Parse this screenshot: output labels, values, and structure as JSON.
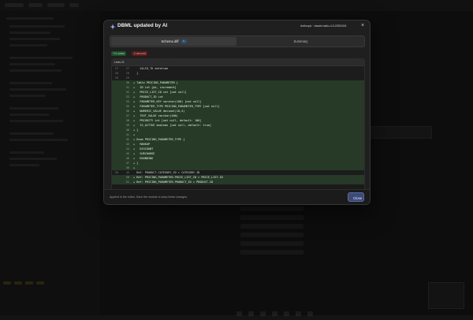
{
  "modal": {
    "title": "DBML updated by AI",
    "model_label": "Anthropic · claude-haiku-4-5-20251001",
    "close_icon_glyph": "×"
  },
  "tabs": {
    "schema_diff": "Schema diff",
    "schema_diff_badge": "1",
    "summary": "Summary"
  },
  "stats": {
    "added": "+21 added",
    "removed": "-0 removed"
  },
  "diff": {
    "header": "Lines 21",
    "lines": [
      {
        "old": "27",
        "new": "27",
        "type": "ctx",
        "code": "    VALID_TO datetime"
      },
      {
        "old": "28",
        "new": "28",
        "type": "ctx",
        "code": "  }"
      },
      {
        "old": "29",
        "new": "29",
        "type": "ctx",
        "code": ""
      },
      {
        "old": "",
        "new": "30",
        "type": "add",
        "code": "+ Table PRICING_PARAMETER {"
      },
      {
        "old": "",
        "new": "31",
        "type": "add",
        "code": "+   ID int [pk, increment]"
      },
      {
        "old": "",
        "new": "32",
        "type": "add",
        "code": "+   PRICE_LIST_ID int [not null]"
      },
      {
        "old": "",
        "new": "33",
        "type": "add",
        "code": "+   PRODUCT_ID int"
      },
      {
        "old": "",
        "new": "34",
        "type": "add",
        "code": "+   PARAMETER_KEY varchar(100) [not null]"
      },
      {
        "old": "",
        "new": "35",
        "type": "add",
        "code": "+   PARAMETER_TYPE PRICING_PARAMETER_TYPE [not null]"
      },
      {
        "old": "",
        "new": "36",
        "type": "add",
        "code": "+   NUMERIC_VALUE decimal(18,4)"
      },
      {
        "old": "",
        "new": "37",
        "type": "add",
        "code": "+   TEXT_VALUE varchar(400)"
      },
      {
        "old": "",
        "new": "38",
        "type": "add",
        "code": "+   PRIORITY int [not null, default: 100]"
      },
      {
        "old": "",
        "new": "39",
        "type": "add",
        "code": "+   IS_ACTIVE boolean [not null, default: true]"
      },
      {
        "old": "",
        "new": "40",
        "type": "add",
        "code": "+ }"
      },
      {
        "old": "",
        "new": "41",
        "type": "add",
        "code": "+"
      },
      {
        "old": "",
        "new": "42",
        "type": "add",
        "code": "+ Enum PRICING_PARAMETER_TYPE {"
      },
      {
        "old": "",
        "new": "43",
        "type": "add",
        "code": "+   MARKUP"
      },
      {
        "old": "",
        "new": "44",
        "type": "add",
        "code": "+   DISCOUNT"
      },
      {
        "old": "",
        "new": "45",
        "type": "add",
        "code": "+   SURCHARGE"
      },
      {
        "old": "",
        "new": "46",
        "type": "add",
        "code": "+   ROUNDING"
      },
      {
        "old": "",
        "new": "47",
        "type": "add",
        "code": "+ }"
      },
      {
        "old": "",
        "new": "48",
        "type": "add",
        "code": "+"
      },
      {
        "old": "30",
        "new": "49",
        "type": "ctx",
        "code": "  Ref: PRODUCT.CATEGORY_ID > CATEGORY.ID"
      },
      {
        "old": "",
        "new": "50",
        "type": "add",
        "code": "+ Ref: PRICING_PARAMETER.PRICE_LIST_ID > PRICE_LIST.ID"
      },
      {
        "old": "",
        "new": "51",
        "type": "add",
        "code": "+ Ref: PRICING_PARAMETER.PRODUCT_ID > PRODUCT.ID"
      }
    ]
  },
  "footer": {
    "note": "Applied to the editor. Save the module to keep these changes.",
    "close_label": "Close"
  },
  "colors": {
    "accent": "#3c4a78",
    "added_bg": "#263a27",
    "modal_bg": "#1f1f1f"
  },
  "icons": {
    "title_icon": "ai-sparkle-icon",
    "close": "close-icon"
  }
}
